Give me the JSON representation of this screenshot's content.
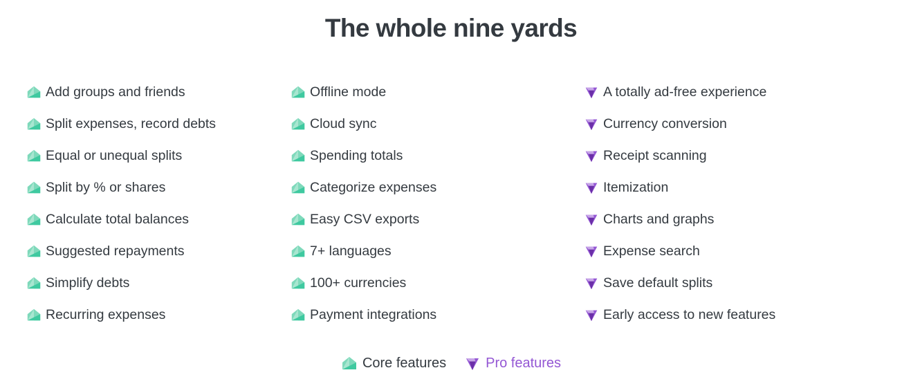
{
  "header": {
    "title": "The whole nine yards"
  },
  "colors": {
    "text": "#343a40",
    "core_gem_light": "#a8e6d0",
    "core_gem_mid": "#7fd9bb",
    "core_gem_dark": "#3fc9a0",
    "pro_gem_light": "#c7a6e8",
    "pro_gem_mid": "#9457d4",
    "pro_gem_dark": "#6b2fa8",
    "pro_text": "#9457d4",
    "background": "#ffffff"
  },
  "columns": [
    {
      "name": "core-column-1",
      "items": [
        {
          "icon": "core-gem-icon",
          "tier": "core",
          "label": "Add groups and friends"
        },
        {
          "icon": "core-gem-icon",
          "tier": "core",
          "label": "Split expenses, record debts"
        },
        {
          "icon": "core-gem-icon",
          "tier": "core",
          "label": "Equal or unequal splits"
        },
        {
          "icon": "core-gem-icon",
          "tier": "core",
          "label": "Split by % or shares"
        },
        {
          "icon": "core-gem-icon",
          "tier": "core",
          "label": "Calculate total balances"
        },
        {
          "icon": "core-gem-icon",
          "tier": "core",
          "label": "Suggested repayments"
        },
        {
          "icon": "core-gem-icon",
          "tier": "core",
          "label": "Simplify debts"
        },
        {
          "icon": "core-gem-icon",
          "tier": "core",
          "label": "Recurring expenses"
        }
      ]
    },
    {
      "name": "core-column-2",
      "items": [
        {
          "icon": "core-gem-icon",
          "tier": "core",
          "label": "Offline mode"
        },
        {
          "icon": "core-gem-icon",
          "tier": "core",
          "label": "Cloud sync"
        },
        {
          "icon": "core-gem-icon",
          "tier": "core",
          "label": "Spending totals"
        },
        {
          "icon": "core-gem-icon",
          "tier": "core",
          "label": "Categorize expenses"
        },
        {
          "icon": "core-gem-icon",
          "tier": "core",
          "label": "Easy CSV exports"
        },
        {
          "icon": "core-gem-icon",
          "tier": "core",
          "label": "7+ languages"
        },
        {
          "icon": "core-gem-icon",
          "tier": "core",
          "label": "100+ currencies"
        },
        {
          "icon": "core-gem-icon",
          "tier": "core",
          "label": "Payment integrations"
        }
      ]
    },
    {
      "name": "pro-column-3",
      "items": [
        {
          "icon": "pro-gem-icon",
          "tier": "pro",
          "label": "A totally ad-free experience"
        },
        {
          "icon": "pro-gem-icon",
          "tier": "pro",
          "label": "Currency conversion"
        },
        {
          "icon": "pro-gem-icon",
          "tier": "pro",
          "label": "Receipt scanning"
        },
        {
          "icon": "pro-gem-icon",
          "tier": "pro",
          "label": "Itemization"
        },
        {
          "icon": "pro-gem-icon",
          "tier": "pro",
          "label": "Charts and graphs"
        },
        {
          "icon": "pro-gem-icon",
          "tier": "pro",
          "label": "Expense search"
        },
        {
          "icon": "pro-gem-icon",
          "tier": "pro",
          "label": "Save default splits"
        },
        {
          "icon": "pro-gem-icon",
          "tier": "pro",
          "label": "Early access to new features"
        }
      ]
    }
  ],
  "legend": [
    {
      "name": "legend-core",
      "tier": "core",
      "icon": "core-gem-icon",
      "label": "Core features"
    },
    {
      "name": "legend-pro",
      "tier": "pro",
      "icon": "pro-gem-icon",
      "label": "Pro features"
    }
  ]
}
